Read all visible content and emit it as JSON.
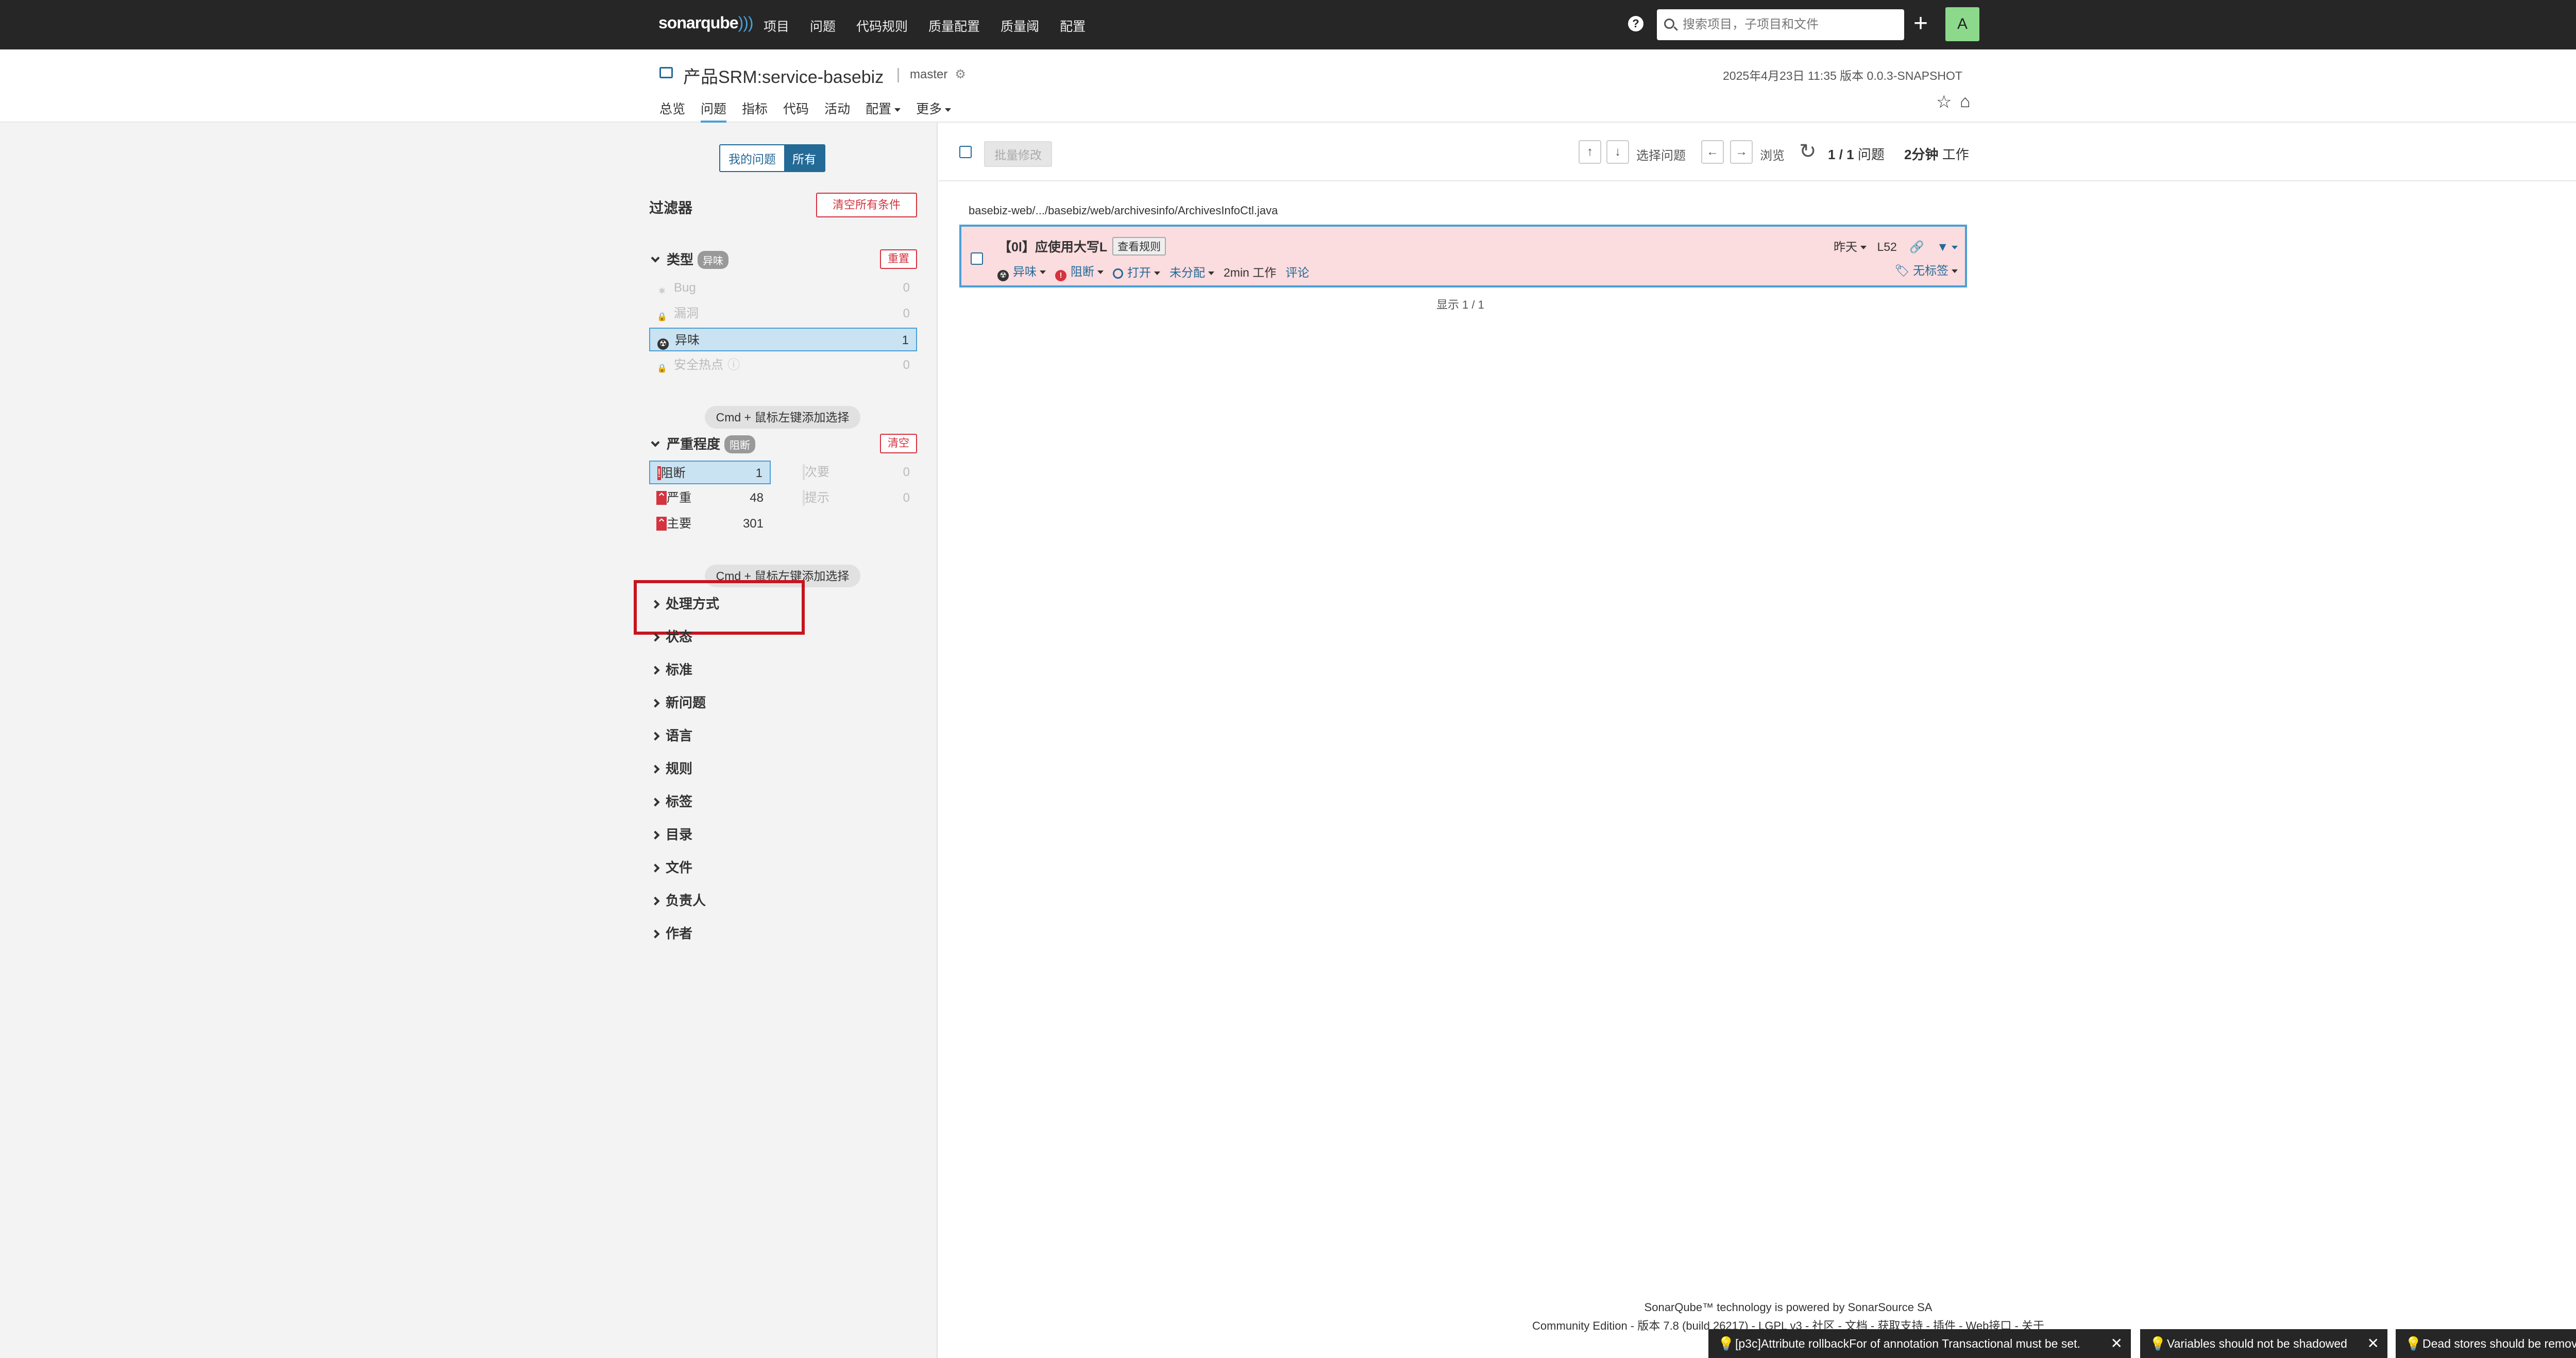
{
  "topbar": {
    "brand_main": "sonarqube",
    "nav": [
      "项目",
      "问题",
      "代码规则",
      "质量配置",
      "质量阈",
      "配置"
    ],
    "help": "?",
    "search_placeholder": "搜索项目，子项目和文件",
    "plus": "+",
    "avatar": "A"
  },
  "project": {
    "title": "产品SRM:service-basebiz",
    "branch": "master",
    "meta": "2025年4月23日 11:35  版本 0.0.3-SNAPSHOT",
    "tabs": [
      "总览",
      "问题",
      "指标",
      "代码",
      "活动",
      "配置",
      "更多"
    ],
    "active_tab": "问题"
  },
  "sidebar": {
    "seg_mine": "我的问题",
    "seg_all": "所有",
    "filter_title": "过滤器",
    "clear_all": "清空所有条件",
    "type": {
      "label": "类型",
      "pill": "异味",
      "reset": "重置",
      "rows": [
        {
          "label": "Bug",
          "count": "0"
        },
        {
          "label": "漏洞",
          "count": "0"
        },
        {
          "label": "异味",
          "count": "1"
        },
        {
          "label": "安全热点",
          "count": "0"
        }
      ]
    },
    "hint": "Cmd + 鼠标左键添加选择",
    "severity": {
      "label": "严重程度",
      "pill": "阻断",
      "clear": "清空",
      "rows": [
        {
          "label": "阻断",
          "count": "1"
        },
        {
          "label": "次要",
          "count": "0"
        },
        {
          "label": "严重",
          "count": "48"
        },
        {
          "label": "提示",
          "count": "0"
        },
        {
          "label": "主要",
          "count": "301"
        }
      ]
    },
    "collapsed": [
      "处理方式",
      "状态",
      "标准",
      "新问题",
      "语言",
      "规则",
      "标签",
      "目录",
      "文件",
      "负责人",
      "作者"
    ]
  },
  "toolbar": {
    "bulk": "批量修改",
    "up": "↑",
    "down": "↓",
    "select_issue": "选择问题",
    "left": "←",
    "right": "→",
    "browse": "浏览",
    "reload": "↻",
    "count": "1 / 1",
    "count_label": "问题",
    "effort": "2分钟",
    "effort_label": "工作"
  },
  "issue": {
    "path": "basebiz-web/.../basebiz/web/archivesinfo/ArchivesInfoCtl.java",
    "title": "【0l】应使用大写L",
    "rule_button": "查看规则",
    "type": "异味",
    "severity": "阻断",
    "status": "打开",
    "assignee": "未分配",
    "effort": "2min 工作",
    "comment": "评论",
    "when": "昨天",
    "line": "L52",
    "tags": "无标签",
    "shown": "显示 1 / 1"
  },
  "footer": {
    "line1": "SonarQube™ technology is powered by SonarSource SA",
    "line2": "Community Edition - 版本 7.8 (build 26217) - LGPL v3 - 社区 - 文档 - 获取支持 - 插件 - Web接口 - 关于"
  },
  "toasts": [
    "[p3c]Attribute rollbackFor of annotation Transactional must be set.",
    "Variables should not be shadowed",
    "Dead stores should be removed"
  ],
  "colors": {
    "topbar": "#262626",
    "accent": "#236a97",
    "red": "#d4333f",
    "issue_bg": "#fbdcdf",
    "selected": "#cae3f2"
  }
}
